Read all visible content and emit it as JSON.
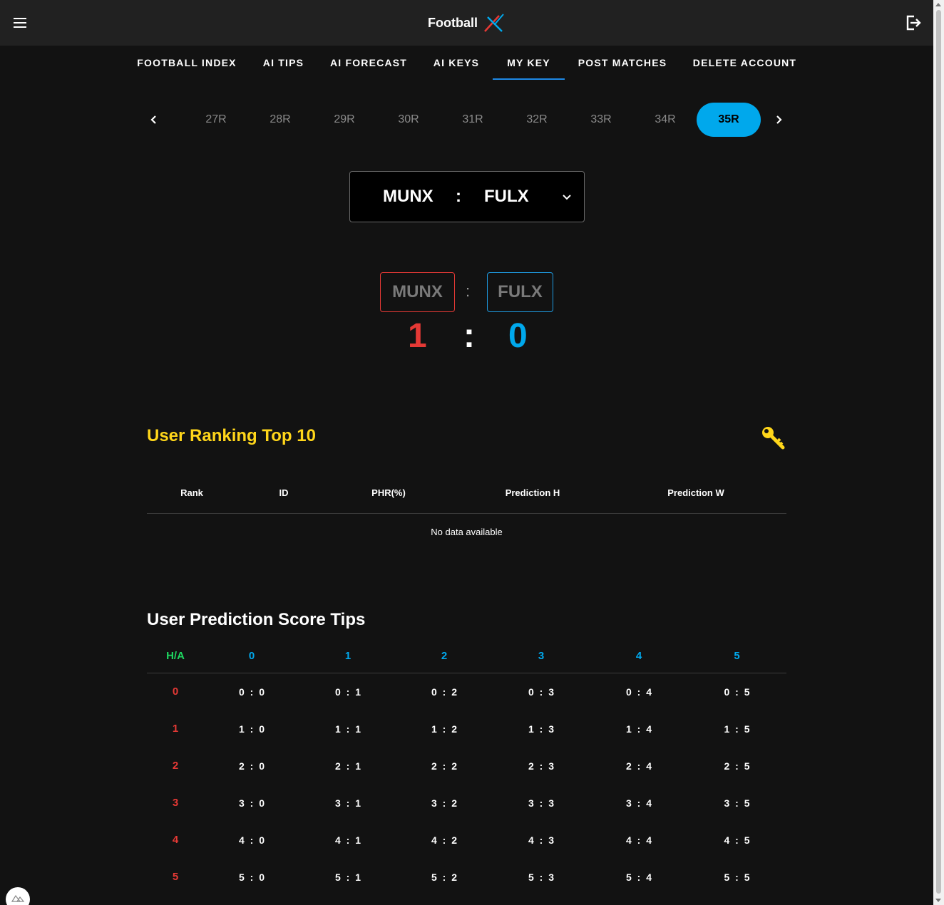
{
  "header": {
    "logo_text": "Football",
    "menu_icon": "hamburger-icon",
    "logout_icon": "logout-icon"
  },
  "nav": {
    "items": [
      {
        "label": "FOOTBALL INDEX"
      },
      {
        "label": "AI TIPS"
      },
      {
        "label": "AI FORECAST"
      },
      {
        "label": "AI KEYS"
      },
      {
        "label": "MY KEY",
        "active": true
      },
      {
        "label": "POST MATCHES"
      },
      {
        "label": "DELETE ACCOUNT"
      }
    ]
  },
  "rounds": {
    "items": [
      "27R",
      "28R",
      "29R",
      "30R",
      "31R",
      "32R",
      "33R",
      "34R",
      "35R"
    ],
    "selected": "35R"
  },
  "match_select": {
    "home": "MUNX",
    "separator": ":",
    "away": "FULX"
  },
  "match": {
    "home_team": "MUNX",
    "away_team": "FULX",
    "team_separator": ":",
    "home_score": "1",
    "away_score": "0",
    "score_separator": ":"
  },
  "ranking": {
    "title": "User Ranking Top 10",
    "columns": [
      "Rank",
      "ID",
      "PHR(%)",
      "Prediction H",
      "Prediction W"
    ],
    "empty_text": "No data available"
  },
  "tips": {
    "title": "User Prediction Score Tips",
    "corner": "H/A",
    "away_goals": [
      "0",
      "1",
      "2",
      "3",
      "4",
      "5"
    ],
    "home_goals": [
      "0",
      "1",
      "2",
      "3",
      "4",
      "5"
    ]
  },
  "colors": {
    "background": "#121212",
    "topbar": "#212121",
    "accent_blue": "#00a8ec",
    "home_red": "#e53935",
    "ranking_yellow": "#ffd61a",
    "ha_green": "#1ed760"
  }
}
